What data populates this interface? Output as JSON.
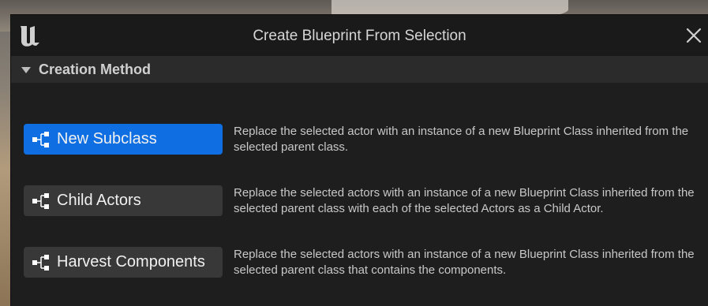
{
  "dialog": {
    "title": "Create Blueprint From Selection"
  },
  "section": {
    "label": "Creation Method"
  },
  "options": [
    {
      "label": "New Subclass",
      "description": "Replace the selected actor with an instance of a new Blueprint Class inherited from the selected parent class.",
      "selected": true
    },
    {
      "label": "Child Actors",
      "description": "Replace the selected actors with an instance of a new Blueprint Class inherited from the selected parent class with each of the selected Actors as a Child Actor.",
      "selected": false
    },
    {
      "label": "Harvest Components",
      "description": "Replace the selected actors with an instance of a new Blueprint Class inherited from the selected parent class that contains the components.",
      "selected": false
    }
  ],
  "colors": {
    "accent": "#0f6fe2",
    "button": "#383838",
    "panel": "#1e1e1e"
  },
  "icons": {
    "logo": "unreal-logo-icon",
    "close": "close-icon",
    "section": "chevron-down-icon",
    "option": "node-hierarchy-icon"
  }
}
